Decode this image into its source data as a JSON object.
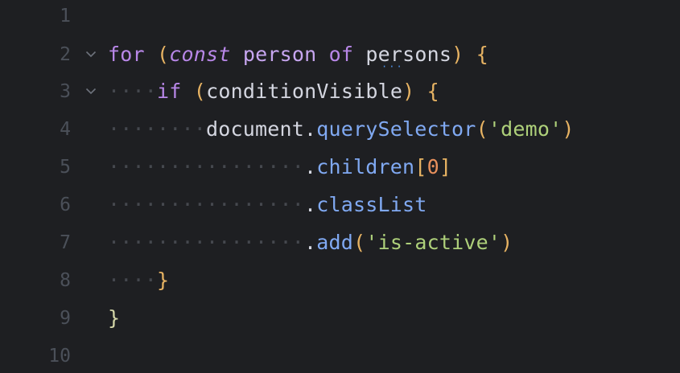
{
  "editor": {
    "colors": {
      "background": "#1e1f22",
      "line_number": "#4b5059",
      "keyword": "#b887e8",
      "function": "#80a9f2",
      "string": "#aed07a",
      "number": "#e8905c",
      "bracket": "#e7b363",
      "whitespace_dot": "#45484e"
    },
    "lines": [
      {
        "number": "1"
      },
      {
        "number": "2",
        "fold": "chevron-down",
        "tokens": {
          "t1": "for",
          "t2": " ",
          "t3": "(",
          "t4": "const",
          "t5": " ",
          "t6": "person",
          "t7": " ",
          "t8": "of",
          "t9": " ",
          "t10": "persons",
          "t11": ")",
          "t12": " ",
          "t13": "{"
        }
      },
      {
        "number": "3",
        "fold": "chevron-down",
        "tokens": {
          "ws": "····",
          "t1": "if",
          "t2": " ",
          "t3": "(",
          "t4": "conditionVisible",
          "t5": ")",
          "t6": " ",
          "t7": "{"
        }
      },
      {
        "number": "4",
        "tokens": {
          "ws": "········",
          "t1": "document",
          "t2": ".",
          "t3": "querySelector",
          "t4": "(",
          "t5": "'demo'",
          "t6": ")"
        }
      },
      {
        "number": "5",
        "tokens": {
          "ws": "················",
          "t1": ".",
          "t2": "children",
          "t3": "[",
          "t4": "0",
          "t5": "]"
        }
      },
      {
        "number": "6",
        "tokens": {
          "ws": "················",
          "t1": ".",
          "t2": "classList"
        }
      },
      {
        "number": "7",
        "tokens": {
          "ws": "················",
          "t1": ".",
          "t2": "add",
          "t3": "(",
          "t4": "'is-active'",
          "t5": ")"
        }
      },
      {
        "number": "8",
        "tokens": {
          "ws": "····",
          "t1": "}"
        }
      },
      {
        "number": "9",
        "tokens": {
          "t1": "}"
        }
      },
      {
        "number": "10"
      }
    ]
  }
}
